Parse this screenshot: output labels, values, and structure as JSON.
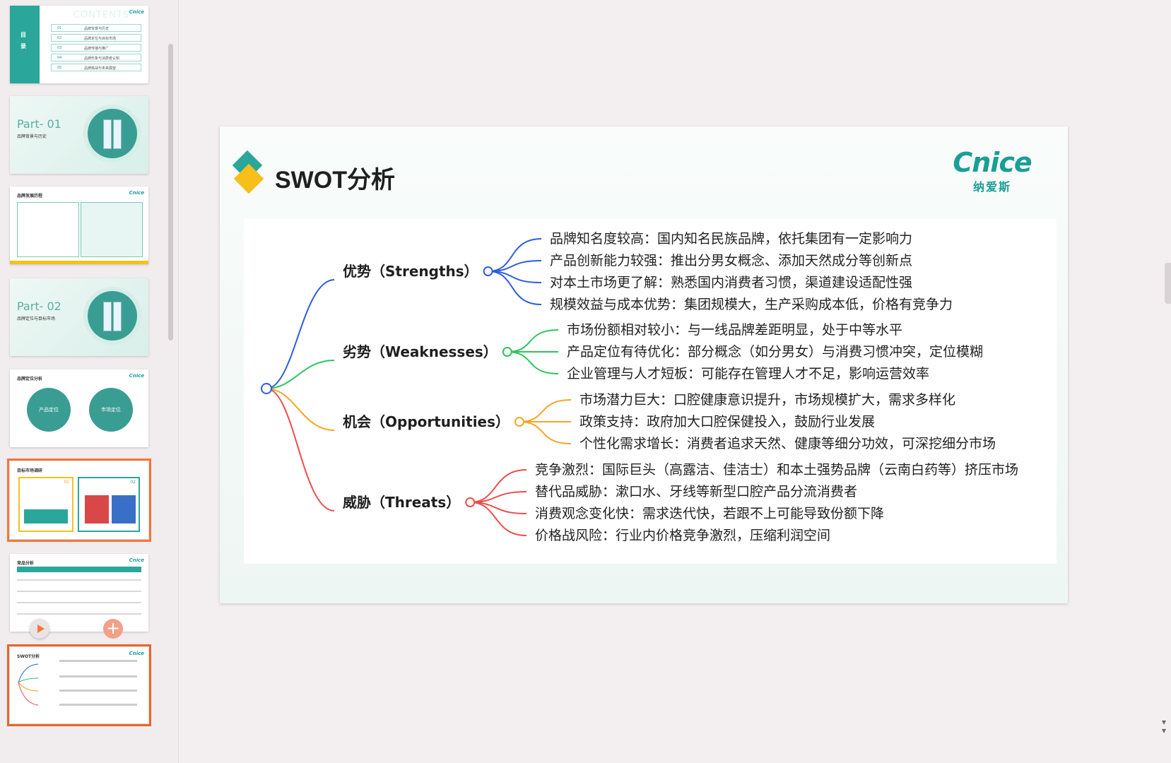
{
  "thumbnails": [
    {
      "kind": "toc",
      "side_chars": [
        "目",
        "录"
      ],
      "heading": "CONTENTS",
      "logo": "Cnice",
      "rows": [
        {
          "num": "01",
          "label": "品牌背景与历史"
        },
        {
          "num": "02",
          "label": "品牌定位与目标市场"
        },
        {
          "num": "03",
          "label": "品牌传播与推广"
        },
        {
          "num": "04",
          "label": "品牌形象与消费者认知"
        },
        {
          "num": "05",
          "label": "品牌挑战与未来展望"
        }
      ]
    },
    {
      "kind": "part",
      "title": "Part- 01",
      "subtitle": "品牌背景与历史"
    },
    {
      "kind": "content",
      "title": "品牌发展历程",
      "logo": "Cnice"
    },
    {
      "kind": "part",
      "title": "Part- 02",
      "subtitle": "品牌定位与目标市场"
    },
    {
      "kind": "content",
      "title": "品牌定位分析",
      "logo": "Cnice",
      "circles": [
        "产品定位",
        "市场定位"
      ]
    },
    {
      "kind": "content",
      "title": "目标市场调研",
      "logo": "Cnice",
      "badges": [
        "01",
        "02"
      ]
    },
    {
      "kind": "content",
      "title": "竞品分析",
      "logo": "Cnice"
    },
    {
      "kind": "content",
      "title": "SWOT分析",
      "logo": "Cnice"
    }
  ],
  "slide": {
    "title": "SWOT分析",
    "brand": {
      "en": "Cnice",
      "cn": "纳爱斯"
    },
    "mindmap": {
      "branches": [
        {
          "label": "优势（Strengths）",
          "color": "#2b5fd9",
          "items": [
            "品牌知名度较高：国内知名民族品牌，依托集团有一定影响力",
            "产品创新能力较强：推出分男女概念、添加天然成分等创新点",
            "对本土市场更了解：熟悉国内消费者习惯，渠道建设适配性强",
            "规模效益与成本优势：集团规模大，生产采购成本低，价格有竞争力"
          ]
        },
        {
          "label": "劣势（Weaknesses）",
          "color": "#2ec45e",
          "items": [
            "市场份额相对较小：与一线品牌差距明显，处于中等水平",
            "产品定位有待优化：部分概念（如分男女）与消费习惯冲突，定位模糊",
            "企业管理与人才短板：可能存在管理人才不足，影响运营效率"
          ]
        },
        {
          "label": "机会（Opportunities）",
          "color": "#f5a623",
          "items": [
            "市场潜力巨大：口腔健康意识提升，市场规模扩大，需求多样化",
            "政策支持：政府加大口腔保健投入，鼓励行业发展",
            "个性化需求增长：消费者追求天然、健康等细分功效，可深挖细分市场"
          ]
        },
        {
          "label": "威胁（Threats）",
          "color": "#ef4b4b",
          "items": [
            "竞争激烈：国际巨头（高露洁、佳洁士）和本土强势品牌（云南白药等）挤压市场",
            "替代品威胁：漱口水、牙线等新型口腔产品分流消费者",
            "消费观念变化快：需求迭代快，若跟不上可能导致份额下降",
            "价格战风险：行业内价格竞争激烈，压缩利润空间"
          ]
        }
      ]
    }
  }
}
